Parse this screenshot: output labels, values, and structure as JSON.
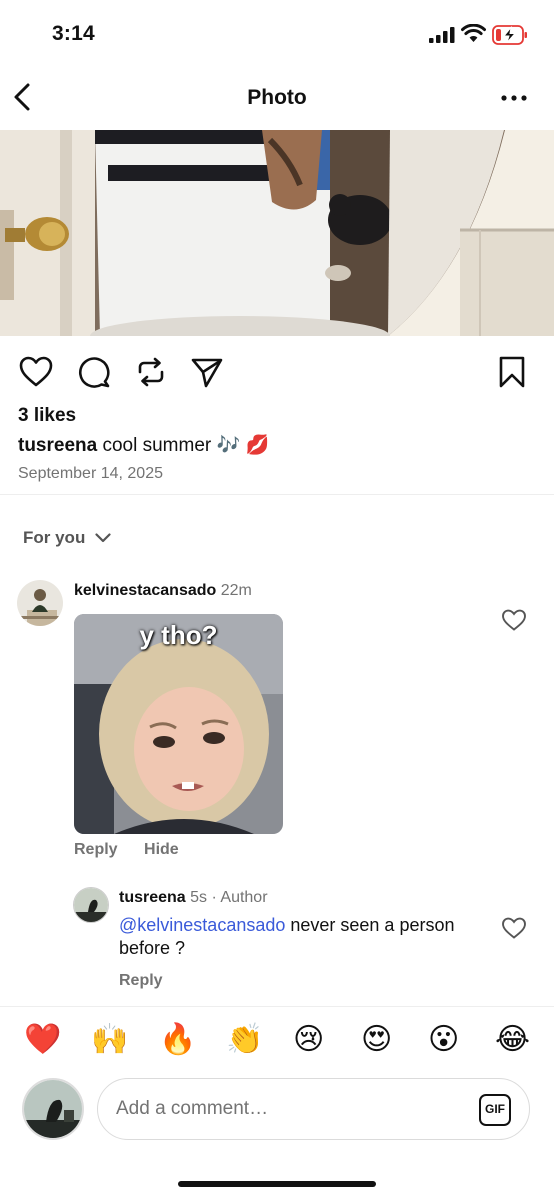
{
  "status": {
    "time": "3:14"
  },
  "header": {
    "title": "Photo"
  },
  "post": {
    "likes": "3 likes",
    "username": "tusreena",
    "caption": "cool summer 🎶 💋",
    "date": "September 14, 2025"
  },
  "filter": {
    "label": "For you"
  },
  "comments": [
    {
      "username": "kelvinestacansado",
      "time": "22m",
      "gif_text": "y tho?",
      "reply_label": "Reply",
      "hide_label": "Hide"
    },
    {
      "username": "tusreena",
      "meta": "5s · Author",
      "mention": "@kelvinestacansado",
      "text": " never seen a person before ?",
      "reply_label": "Reply"
    }
  ],
  "emojis": [
    "❤️",
    "🙌",
    "🔥",
    "👏",
    "😢",
    "😍",
    "😮",
    "😂"
  ],
  "composer": {
    "placeholder": "Add a comment…",
    "gif_label": "GIF"
  },
  "colors": {
    "mention": "#3a5ad9",
    "heart": "#e0245e",
    "battery_low": "#e53935"
  }
}
